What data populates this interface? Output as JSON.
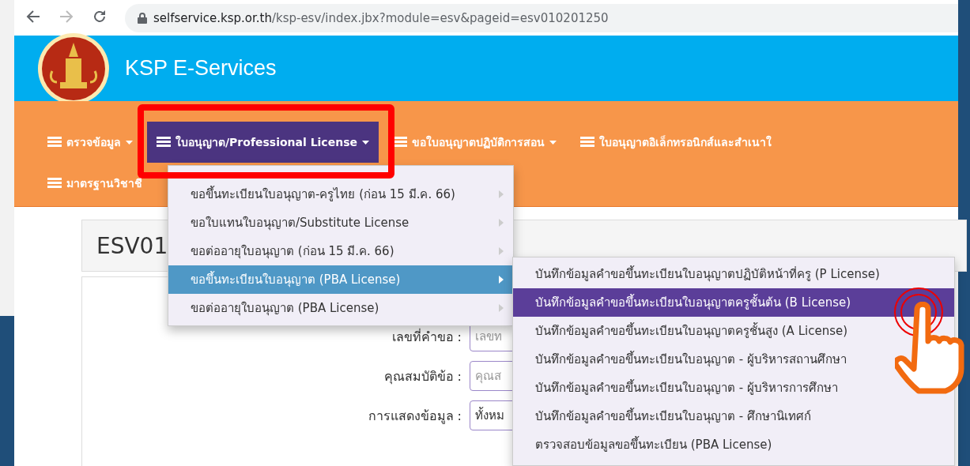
{
  "browser": {
    "url_host": "selfservice.ksp.or.th",
    "url_path": "/ksp-esv/index.jbx?module=esv&pageid=esv010201250"
  },
  "header": {
    "title": "KSP E-Services"
  },
  "nav": {
    "rows": [
      [
        {
          "label": "ตรวจข้อมูล",
          "selected": false,
          "caret": true
        },
        {
          "label": "ใบอนุญาต/Professional License",
          "selected": true,
          "caret": true
        },
        {
          "label": "ขอใบอนุญาตปฏิบัติการสอน",
          "selected": false,
          "caret": true
        },
        {
          "label": "ใบอนุญาตอิเล็กทรอนิกส์และสำเนาใ",
          "selected": false,
          "caret": false
        }
      ],
      [
        {
          "label": "มาตรฐานวิชาชี",
          "selected": false,
          "caret": false
        }
      ]
    ]
  },
  "menu": [
    {
      "label": "ขอขึ้นทะเบียนใบอนุญาต-ครูไทย (ก่อน 15 มี.ค. 66)",
      "selected": false
    },
    {
      "label": "ขอใบแทนใบอนุญาต/Substitute License",
      "selected": false
    },
    {
      "label": "ขอต่ออายุใบอนุญาต (ก่อน 15 มี.ค. 66)",
      "selected": false
    },
    {
      "label": "ขอขึ้นทะเบียนใบอนุญาต (PBA License)",
      "selected": true
    },
    {
      "label": "ขอต่ออายุใบอนุญาต (PBA License)",
      "selected": false
    }
  ],
  "submenu": [
    {
      "label": "บันทึกข้อมูลคำขอขึ้นทะเบียนใบอนุญาตปฏิบัติหน้าที่ครู (P License)",
      "selected": false
    },
    {
      "label": "บันทึกข้อมูลคำขอขึ้นทะเบียนใบอนุญาตครูชั้นต้น (B License)",
      "selected": true
    },
    {
      "label": "บันทึกข้อมูลคำขอขึ้นทะเบียนใบอนุญาตครูชั้นสูง (A License)",
      "selected": false
    },
    {
      "label": "บันทึกข้อมูลคำขอขึ้นทะเบียนใบอนุญาต - ผู้บริหารสถานศึกษา",
      "selected": false
    },
    {
      "label": "บันทึกข้อมูลคำขอขึ้นทะเบียนใบอนุญาต - ผู้บริหารการศึกษา",
      "selected": false
    },
    {
      "label": "บันทึกข้อมูลคำขอขึ้นทะเบียนใบอนุญาต - ศึกษานิเทศก์",
      "selected": false
    },
    {
      "label": "ตรวจสอบข้อมูลขอขึ้นทะเบียน (PBA License)",
      "selected": false
    }
  ],
  "page": {
    "title": "ESV01",
    "fields": [
      {
        "label": "เลขที่คำขอ :",
        "placeholder": "เลขท"
      },
      {
        "label": "คุณสมบัติข้อ :",
        "placeholder": "คุณส"
      },
      {
        "label": "การแสดงข้อมูล :",
        "value": "ทั้งหม"
      }
    ]
  }
}
